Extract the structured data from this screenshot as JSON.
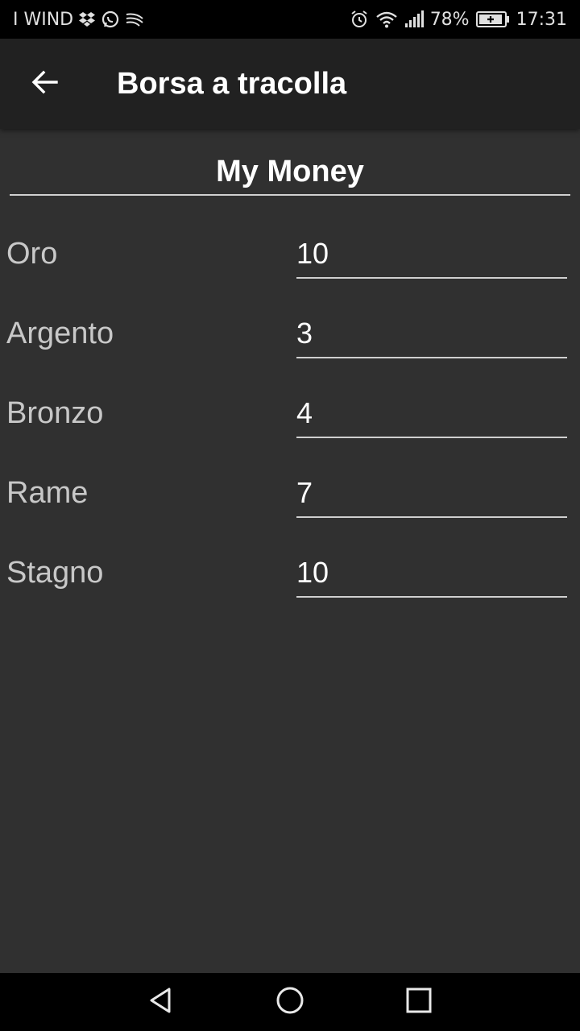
{
  "status_bar": {
    "carrier": "I WIND",
    "battery": "78%",
    "time": "17:31",
    "icons_left": [
      "dropbox-icon",
      "whatsapp-icon",
      "swiftkey-icon"
    ],
    "icons_right": [
      "alarm-icon",
      "wifi-icon",
      "signal-icon",
      "battery-icon"
    ]
  },
  "app_bar": {
    "title": "Borsa a tracolla",
    "back_icon": "arrow-back-icon"
  },
  "section": {
    "title": "My Money"
  },
  "money": [
    {
      "label": "Oro",
      "value": "10"
    },
    {
      "label": "Argento",
      "value": "3"
    },
    {
      "label": "Bronzo",
      "value": "4"
    },
    {
      "label": "Rame",
      "value": "7"
    },
    {
      "label": "Stagno",
      "value": "10"
    }
  ],
  "nav_bar": {
    "icons": [
      "back-triangle-icon",
      "home-circle-icon",
      "recents-square-icon"
    ]
  },
  "colors": {
    "background": "#303030",
    "app_bar": "#212121",
    "status_bar": "#000000",
    "text_primary": "#ffffff",
    "text_label": "#c8c8c8"
  }
}
